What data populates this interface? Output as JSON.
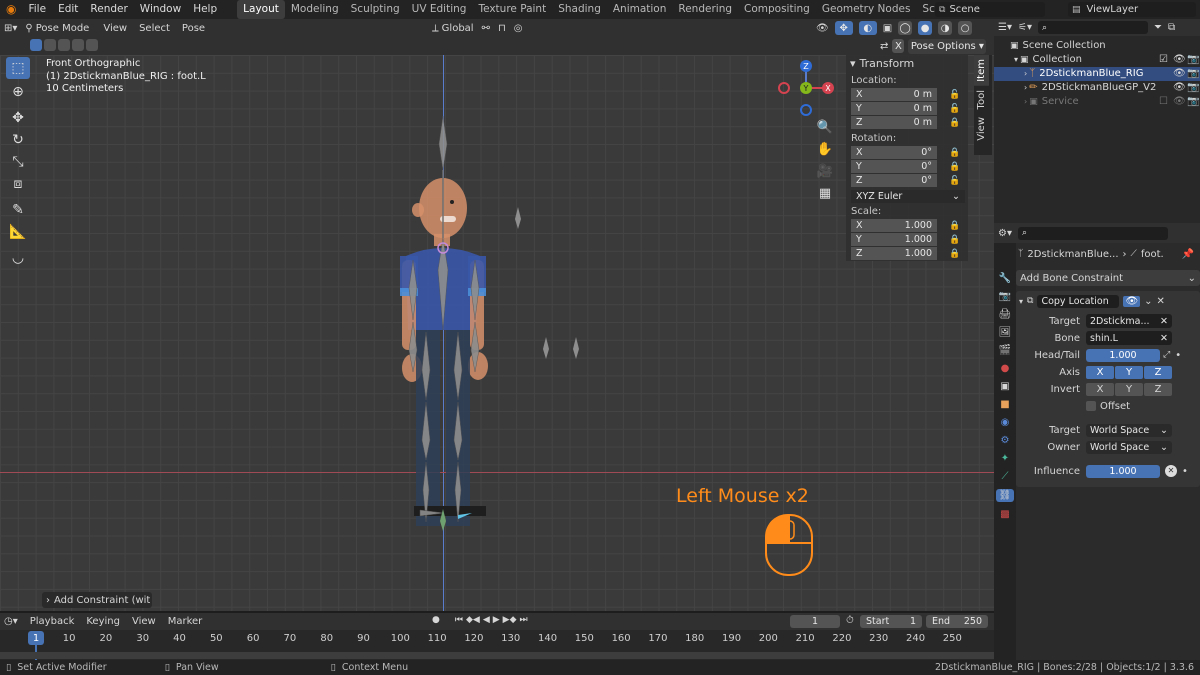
{
  "menu": {
    "items": [
      "File",
      "Edit",
      "Render",
      "Window",
      "Help"
    ]
  },
  "workspaces": {
    "tabs": [
      "Layout",
      "Modeling",
      "Sculpting",
      "UV Editing",
      "Texture Paint",
      "Shading",
      "Animation",
      "Rendering",
      "Compositing",
      "Geometry Nodes",
      "Scripting"
    ],
    "add": "+"
  },
  "scene": {
    "label": "Scene",
    "view_layer": "ViewLayer"
  },
  "viewport_header": {
    "mode": "Pose Mode",
    "view": "View",
    "select": "Select",
    "pose": "Pose",
    "orientation": "Global",
    "pose_options": "Pose Options"
  },
  "overlay": {
    "line1": "Front Orthographic",
    "line2": "(1) 2DstickmanBlue_RIG : foot.L",
    "line3": "10 Centimeters"
  },
  "gizmo": {
    "z": "Z",
    "y": "Y",
    "x": "X"
  },
  "last_op": "Add Constraint (wit",
  "screencast": {
    "text": "Left Mouse x2",
    "color": "#ff8c1a"
  },
  "npanel": {
    "title": "Transform",
    "location_label": "Location:",
    "location": [
      {
        "axis": "X",
        "value": "0 m"
      },
      {
        "axis": "Y",
        "value": "0 m"
      },
      {
        "axis": "Z",
        "value": "0 m"
      }
    ],
    "rotation_label": "Rotation:",
    "rotation": [
      {
        "axis": "X",
        "value": "0°"
      },
      {
        "axis": "Y",
        "value": "0°"
      },
      {
        "axis": "Z",
        "value": "0°"
      }
    ],
    "rotation_mode": "XYZ Euler",
    "scale_label": "Scale:",
    "scale": [
      {
        "axis": "X",
        "value": "1.000"
      },
      {
        "axis": "Y",
        "value": "1.000"
      },
      {
        "axis": "Z",
        "value": "1.000"
      }
    ],
    "tabs": [
      "Item",
      "Tool",
      "View"
    ]
  },
  "outliner": {
    "scene_collection": "Scene Collection",
    "collection": "Collection",
    "items": [
      "2DstickmanBlue_RIG",
      "2DStickmanBlueGP_V2",
      "Service"
    ]
  },
  "properties": {
    "breadcrumb_obj": "2DstickmanBlue...",
    "breadcrumb_bone": "foot.",
    "add_constraint": "Add Bone Constraint",
    "constraint_name": "Copy Location",
    "target_label": "Target",
    "target_value": "2Dstickma...",
    "bone_label": "Bone",
    "bone_value": "shin.L",
    "headtail_label": "Head/Tail",
    "headtail_value": "1.000",
    "axis_label": "Axis",
    "invert_label": "Invert",
    "xyz": [
      "X",
      "Y",
      "Z"
    ],
    "offset_label": "Offset",
    "target_space_label": "Target",
    "target_space": "World Space",
    "owner_space_label": "Owner",
    "owner_space": "World Space",
    "influence_label": "Influence",
    "influence_value": "1.000"
  },
  "timeline": {
    "playback": "Playback",
    "keying": "Keying",
    "view": "View",
    "marker": "Marker",
    "current_frame": "1",
    "start_label": "Start",
    "start": "1",
    "end_label": "End",
    "end": "250",
    "ticks": [
      "1",
      "10",
      "20",
      "30",
      "40",
      "50",
      "60",
      "70",
      "80",
      "90",
      "100",
      "110",
      "120",
      "130",
      "140",
      "150",
      "160",
      "170",
      "180",
      "190",
      "200",
      "210",
      "220",
      "230",
      "240",
      "250"
    ]
  },
  "status": {
    "left1": "Set Active Modifier",
    "left2": "Pan View",
    "left3": "Context Menu",
    "right": "2DstickmanBlue_RIG | Bones:2/28 | Objects:1/2 | 3.3.6"
  }
}
